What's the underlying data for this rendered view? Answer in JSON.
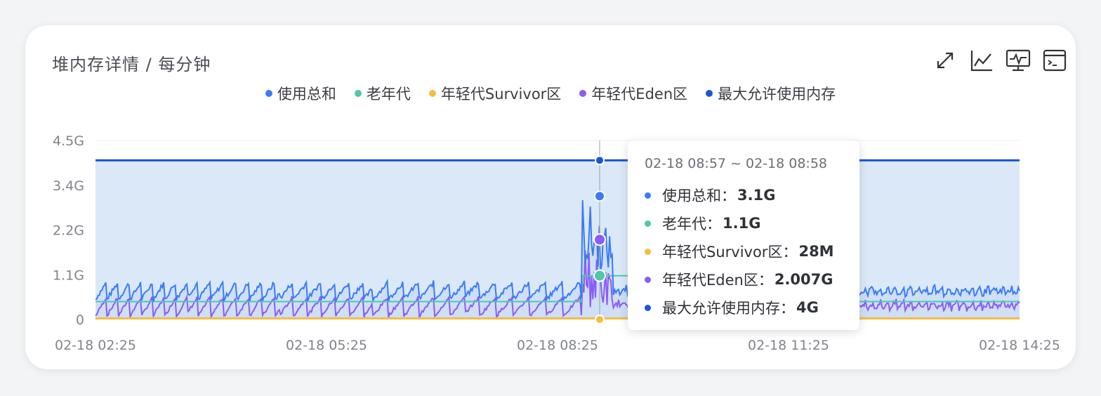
{
  "panel": {
    "title": "堆内存详情 / 每分钟"
  },
  "toolbar": [
    {
      "name": "expand-icon"
    },
    {
      "name": "line-chart-icon"
    },
    {
      "name": "monitor-icon"
    },
    {
      "name": "terminal-icon"
    }
  ],
  "colors": {
    "total": "#3b7bf7",
    "old": "#4fc8a8",
    "survivor": "#f5be3d",
    "eden": "#8b5cf6",
    "max": "#1a56d6",
    "area": "#dbe8f8"
  },
  "chart_data": {
    "type": "line",
    "x_ticks": [
      "02-18 02:25",
      "02-18 05:25",
      "02-18 08:25",
      "02-18 11:25",
      "02-18 14:25"
    ],
    "y_ticks": [
      "0",
      "1.1G",
      "2.2G",
      "3.4G",
      "4.5G"
    ],
    "ylim": [
      0,
      4.5
    ],
    "y_unit": "G",
    "grid": true,
    "legend_position": "top",
    "series": [
      {
        "name": "使用总和",
        "key": "total",
        "baseline": 0.75,
        "spike": 3.1
      },
      {
        "name": "老年代",
        "key": "old",
        "level_before": 0.45,
        "level_after": 1.1,
        "level_late": 0.45
      },
      {
        "name": "年轻代Survivor区",
        "key": "survivor",
        "value": 0.028
      },
      {
        "name": "年轻代Eden区",
        "key": "eden",
        "baseline": 0.3,
        "spike": 2.007
      },
      {
        "name": "最大允许使用内存",
        "key": "max",
        "value": 4
      }
    ],
    "tooltip": {
      "time": "02-18 08:57 ~ 02-18 08:58",
      "rows": [
        {
          "label": "使用总和：",
          "value": "3.1G",
          "key": "total"
        },
        {
          "label": "老年代：",
          "value": "1.1G",
          "key": "old"
        },
        {
          "label": "年轻代Survivor区：",
          "value": "28M",
          "key": "survivor"
        },
        {
          "label": "年轻代Eden区：",
          "value": "2.007G",
          "key": "eden"
        },
        {
          "label": "最大允许使用内存：",
          "value": "4G",
          "key": "max"
        }
      ]
    }
  }
}
